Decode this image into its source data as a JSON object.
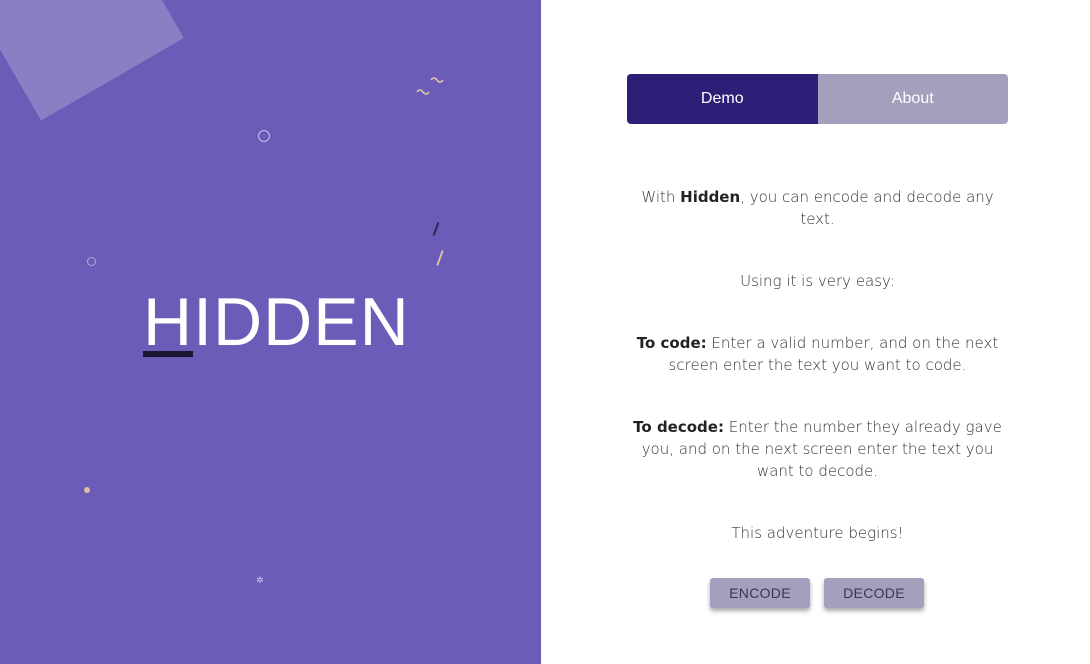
{
  "brand": {
    "title": "HIDDEN"
  },
  "tabs": [
    {
      "label": "Demo",
      "active": true
    },
    {
      "label": "About",
      "active": false
    }
  ],
  "intro": {
    "prefix": "With ",
    "app_name": "Hidden",
    "suffix": ", you can encode and decode any text."
  },
  "usage_text": "Using it is very easy:",
  "encode_info": {
    "label": "To code:",
    "text": " Enter a valid number, and on the next screen enter the text you want to code."
  },
  "decode_info": {
    "label": "To decode:",
    "text": " Enter the number they already gave you, and on the next screen enter the text you want to decode."
  },
  "closing_text": "This adventure begins!",
  "buttons": {
    "encode_label": "ENCODE",
    "decode_label": "DECODE"
  },
  "colors": {
    "panel": "#6a5cb7",
    "tab_active": "#2b1f78",
    "tab_inactive": "#a69ebd",
    "button": "#a69ebd"
  }
}
